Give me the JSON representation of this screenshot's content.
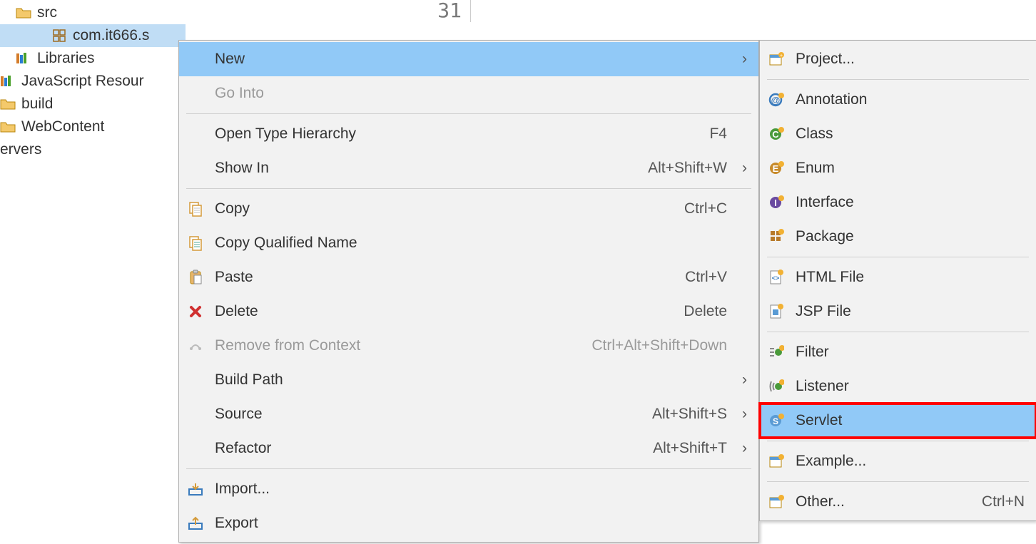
{
  "editor": {
    "line_number": "31"
  },
  "tree": {
    "src": "src",
    "package": "com.it666.s",
    "libraries": "Libraries",
    "js": "JavaScript Resour",
    "build": "build",
    "webcontent": "WebContent",
    "servers": "ervers"
  },
  "context": {
    "new": "New",
    "go_into": "Go Into",
    "open_type_hierarchy": "Open Type Hierarchy",
    "open_type_hierarchy_sc": "F4",
    "show_in": "Show In",
    "show_in_sc": "Alt+Shift+W",
    "copy": "Copy",
    "copy_sc": "Ctrl+C",
    "copy_qualified": "Copy Qualified Name",
    "paste": "Paste",
    "paste_sc": "Ctrl+V",
    "delete": "Delete",
    "delete_sc": "Delete",
    "remove_context": "Remove from Context",
    "remove_context_sc": "Ctrl+Alt+Shift+Down",
    "build_path": "Build Path",
    "source": "Source",
    "source_sc": "Alt+Shift+S",
    "refactor": "Refactor",
    "refactor_sc": "Alt+Shift+T",
    "import": "Import...",
    "export": "Export"
  },
  "newmenu": {
    "project": "Project...",
    "annotation": "Annotation",
    "class": "Class",
    "enum": "Enum",
    "interface": "Interface",
    "package": "Package",
    "html": "HTML File",
    "jsp": "JSP File",
    "filter": "Filter",
    "listener": "Listener",
    "servlet": "Servlet",
    "example": "Example...",
    "other": "Other...",
    "other_sc": "Ctrl+N"
  }
}
